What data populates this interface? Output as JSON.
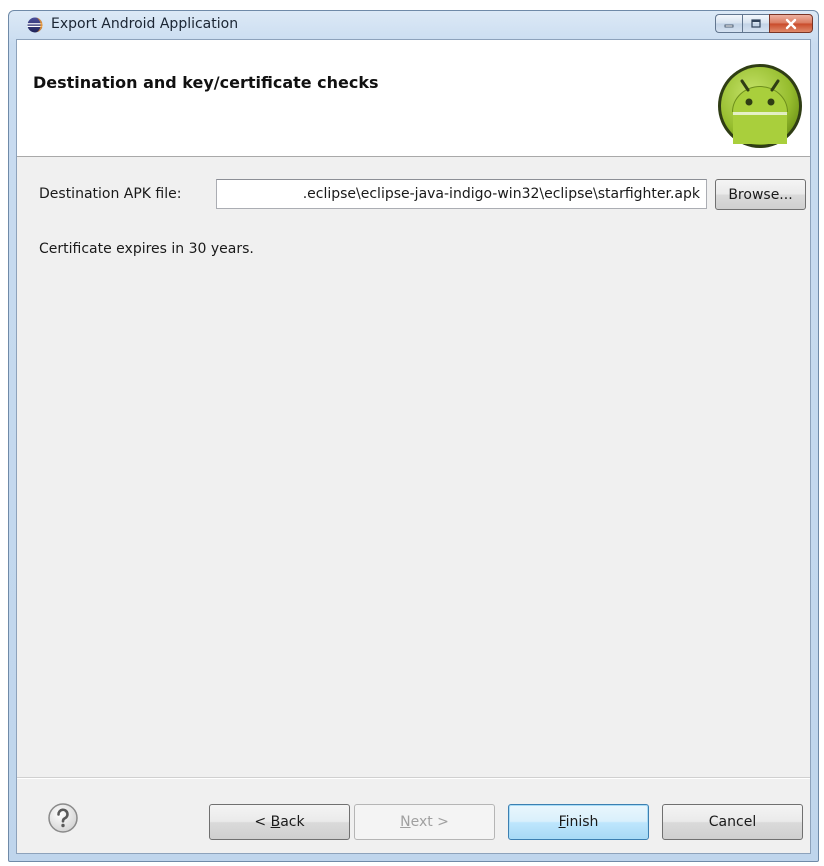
{
  "window": {
    "title": "Export Android Application"
  },
  "banner": {
    "title": "Destination and key/certificate checks",
    "logo_icon": "android-logo-icon"
  },
  "form": {
    "destination_label": "Destination APK file:",
    "destination_value": ".eclipse\\eclipse-java-indigo-win32\\eclipse\\starfighter.apk",
    "browse_label": "Browse...",
    "certificate_text": "Certificate expires in 30 years."
  },
  "buttons": {
    "back_mnemonic": "B",
    "back_prefix": "< ",
    "back_rest": "ack",
    "next_mnemonic": "N",
    "next_rest": "ext >",
    "finish_mnemonic": "F",
    "finish_rest": "inish",
    "cancel_label": "Cancel"
  },
  "icons": {
    "title": "eclipse-icon",
    "help": "help-icon",
    "minimize": "minimize-icon",
    "maximize": "maximize-icon",
    "close": "close-icon"
  },
  "colors": {
    "title_bar": "#c9dcf0",
    "content_bg": "#f0f0f0",
    "android_green": "#a4c639",
    "default_button_border": "#3c7fb1",
    "close_button": "#c94a2a"
  }
}
